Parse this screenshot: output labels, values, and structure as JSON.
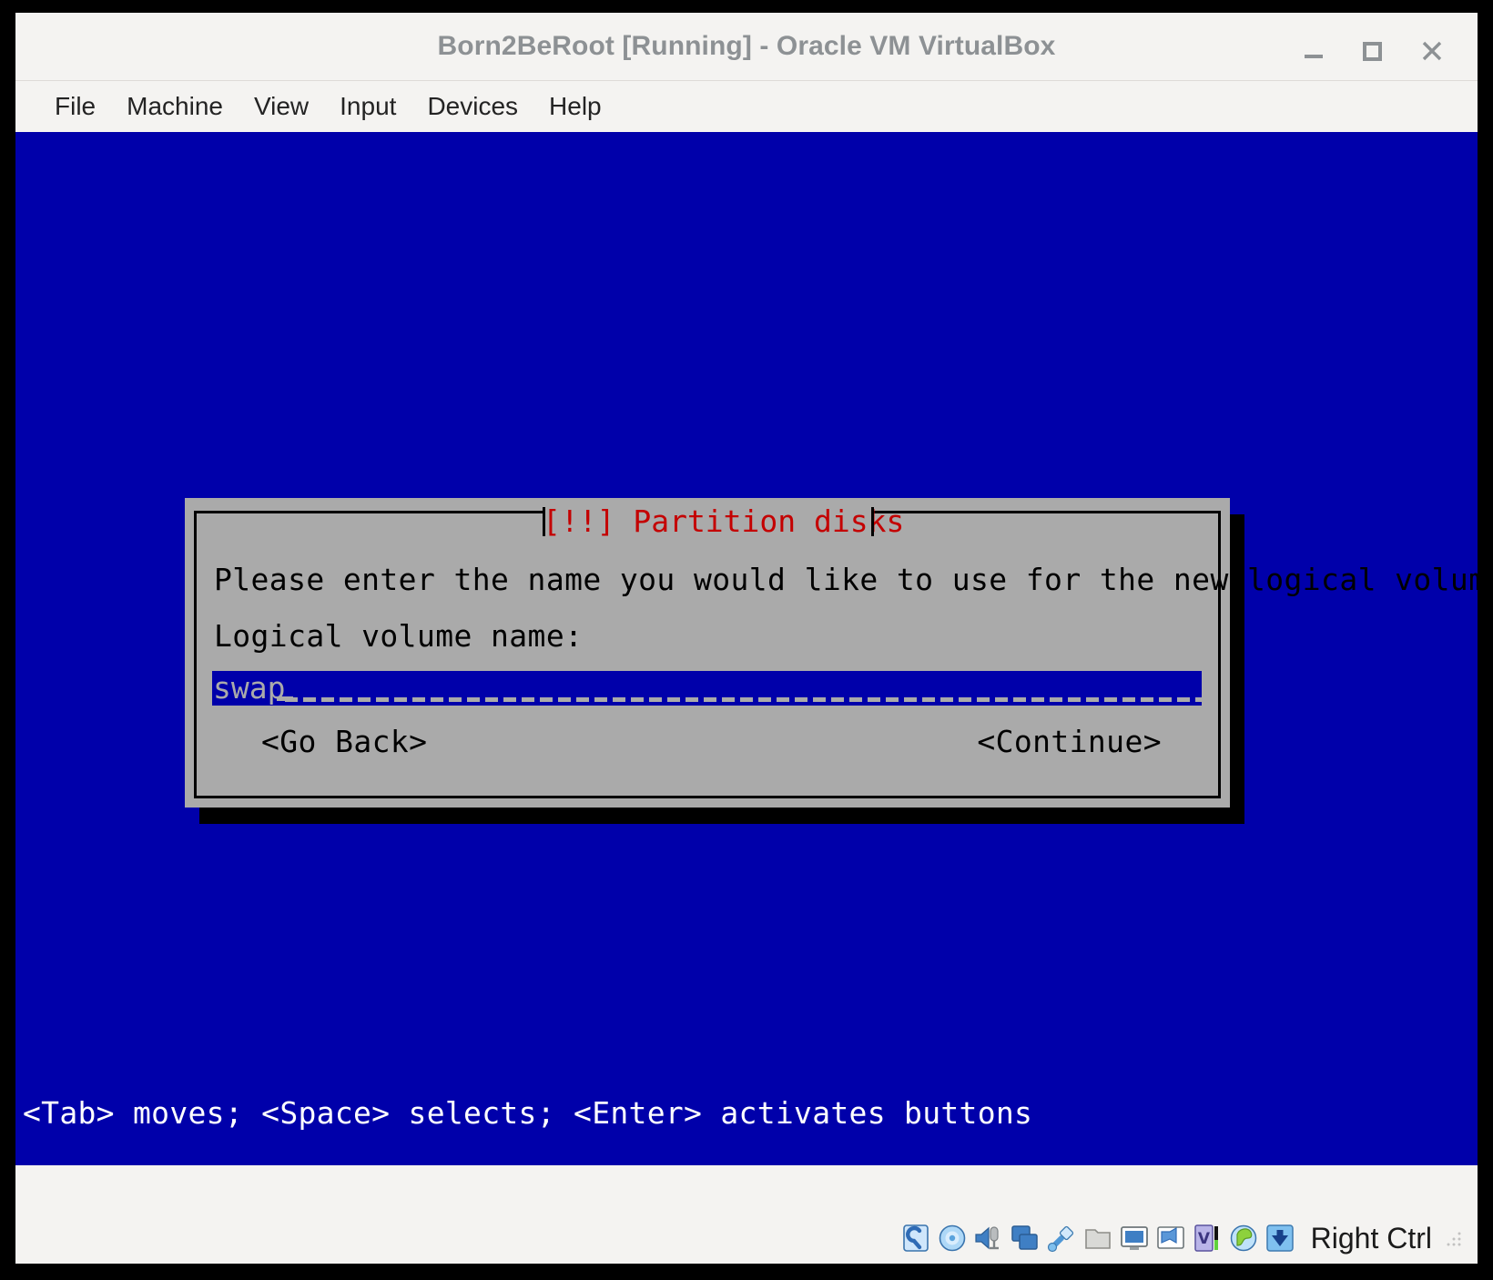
{
  "window": {
    "title": "Born2BeRoot [Running] - Oracle VM VirtualBox",
    "controls": {
      "minimize": "minimize-icon",
      "maximize": "maximize-icon",
      "close": "close-icon"
    }
  },
  "menubar": {
    "items": [
      {
        "label": "File"
      },
      {
        "label": "Machine"
      },
      {
        "label": "View"
      },
      {
        "label": "Input"
      },
      {
        "label": "Devices"
      },
      {
        "label": "Help"
      }
    ]
  },
  "vm_screen": {
    "background_color": "#0000aa",
    "help_line": "<Tab> moves; <Space> selects; <Enter> activates buttons"
  },
  "dialog": {
    "title": "[!!] Partition disks",
    "title_color": "#c40000",
    "background_color": "#aaaaaa",
    "prompt": "Please enter the name you would like to use for the new logical volume.",
    "field_label": "Logical volume name:",
    "input": {
      "value": "swap",
      "placeholder": "",
      "highlight_color": "#0000aa",
      "text_color": "#aaaaaa"
    },
    "buttons": {
      "go_back": "<Go Back>",
      "continue": "<Continue>"
    }
  },
  "statusbar": {
    "icons": [
      "hard-disk-icon",
      "optical-disk-icon",
      "audio-icon",
      "network-icon",
      "usb-icon",
      "shared-folder-icon",
      "display-icon",
      "video-capture-icon",
      "virtualization-icon",
      "mouse-integration-icon",
      "host-key-down-icon"
    ],
    "host_key": "Right Ctrl"
  }
}
